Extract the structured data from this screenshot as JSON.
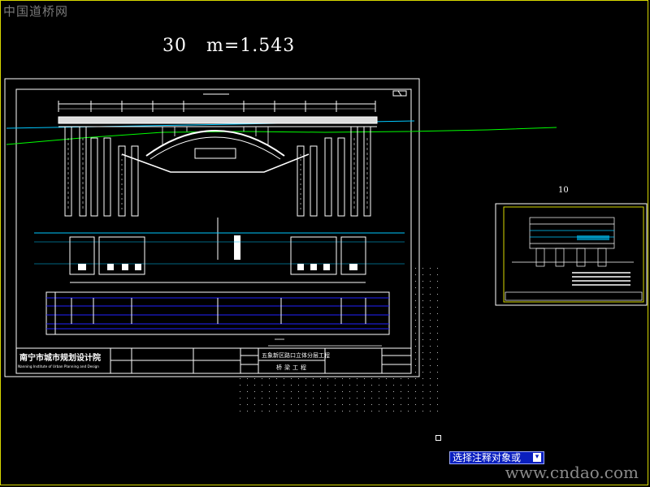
{
  "watermark_top": "中国道桥网",
  "watermark_bottom": "www.cndao.com",
  "scale_annotation": "30   m=1.543",
  "small_sheet_label": "10",
  "command_prompt": "选择注释对象或",
  "prompt_icon": "dropdown-icon",
  "title_block": {
    "institute_name": "南宁市城市规划设计院",
    "institute_name_en": "Nanning Institute of Urban Planning and Design",
    "project_name": "五象新区路口立体分层工程",
    "drawing_title": "桥梁工程"
  },
  "colors": {
    "background": "#000000",
    "frame": "#d8d800",
    "drawing_border": "#ffffff",
    "table_lines": "#2222ff",
    "cyan_lines": "#00c8ff",
    "green_line": "#00ff00",
    "prompt_bg": "#0a1fbe"
  }
}
